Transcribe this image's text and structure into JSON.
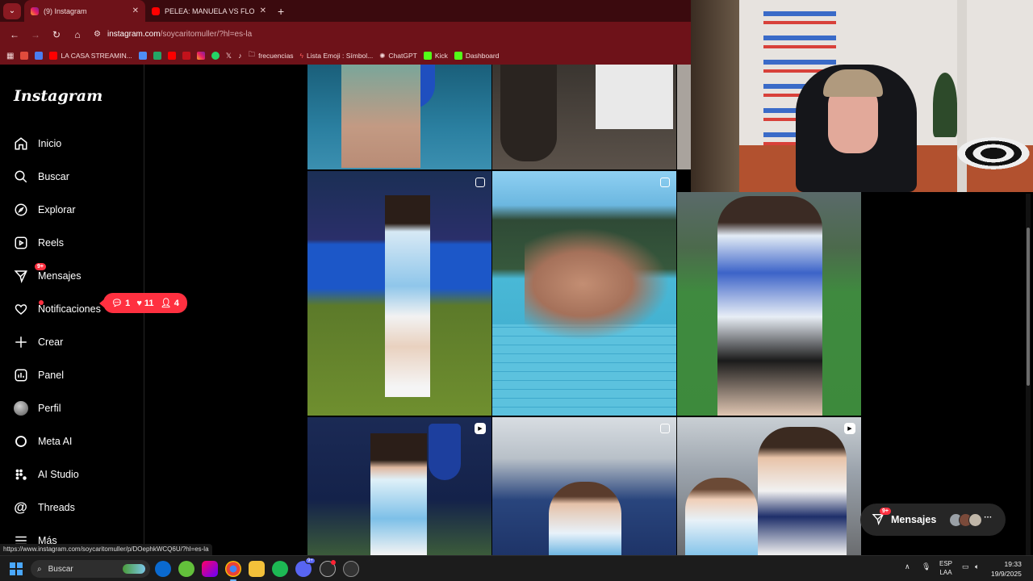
{
  "browser": {
    "tabs": [
      {
        "title": "(9) Instagram",
        "active": true
      },
      {
        "title": "PELEA: MANUELA VS FLOR VIGI",
        "active": false
      }
    ],
    "url_host": "instagram.com",
    "url_path": "/soycaritomuller/?hl=es-la",
    "bookmarks": [
      "LA CASA STREAMIN...",
      "frecuencias",
      "Lista Emoji : Símbol...",
      "ChatGPT",
      "Kick",
      "Dashboard"
    ]
  },
  "instagram": {
    "logo": "Instagram",
    "nav": [
      {
        "label": "Inicio",
        "icon": "home-icon"
      },
      {
        "label": "Buscar",
        "icon": "search-icon"
      },
      {
        "label": "Explorar",
        "icon": "compass-icon"
      },
      {
        "label": "Reels",
        "icon": "reels-icon"
      },
      {
        "label": "Mensajes",
        "icon": "messenger-icon",
        "badge": "9+"
      },
      {
        "label": "Notificaciones",
        "icon": "heart-icon"
      },
      {
        "label": "Crear",
        "icon": "plus-icon"
      },
      {
        "label": "Panel",
        "icon": "chart-icon"
      },
      {
        "label": "Perfil",
        "icon": "avatar-icon"
      },
      {
        "label": "Meta AI",
        "icon": "meta-ai-icon"
      },
      {
        "label": "AI Studio",
        "icon": "ai-studio-icon"
      },
      {
        "label": "Threads",
        "icon": "threads-icon"
      },
      {
        "label": "Más",
        "icon": "menu-icon"
      }
    ],
    "notifications": {
      "comments": "1",
      "likes": "11",
      "follows": "4"
    },
    "messages_pill": {
      "label": "Mensajes",
      "badge": "9+"
    }
  },
  "status_url": "https://www.instagram.com/soycaritomuller/p/DOephkWCQ6U/?hl=es-la",
  "taskbar": {
    "search": "Buscar",
    "discord_badge": "9+",
    "lang_top": "ESP",
    "lang_bottom": "LAA",
    "time": "19:33",
    "date": "19/9/2025"
  },
  "colors": {
    "accent": "#ff3040",
    "chrome": "#6e1219",
    "tabbar": "#3b0a0e"
  }
}
